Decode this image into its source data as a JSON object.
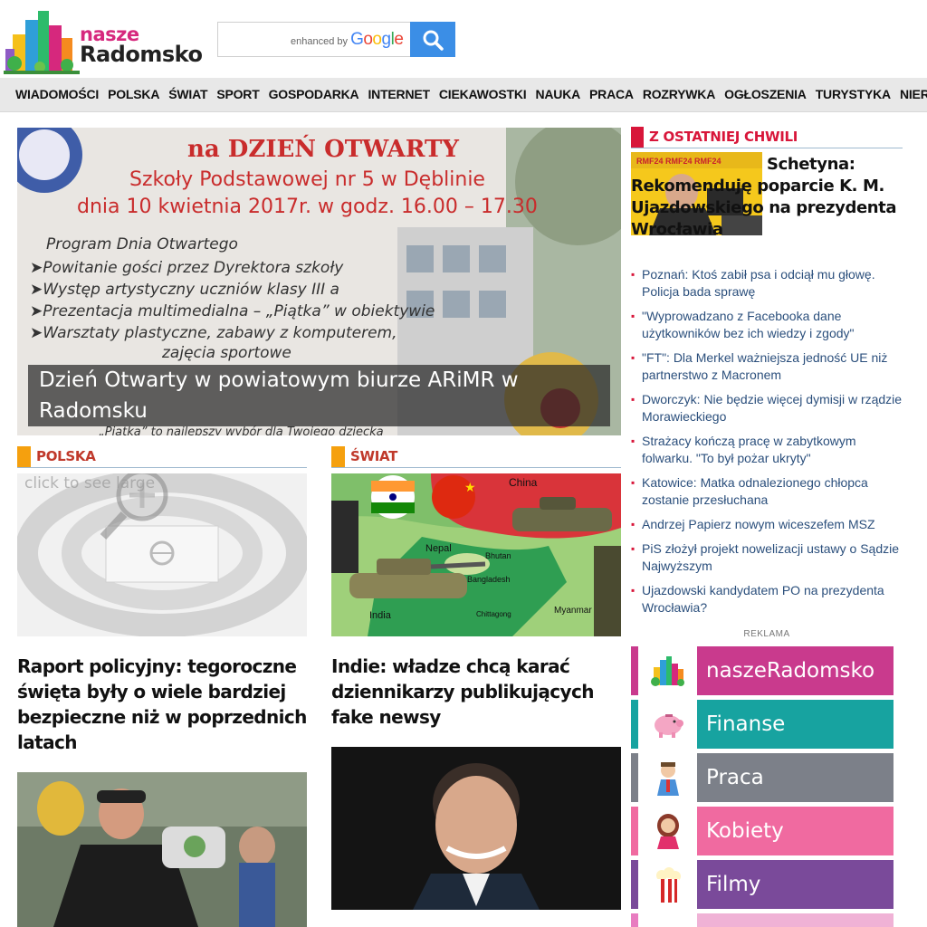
{
  "logo": {
    "line1": "nasze",
    "line2": "Radomsko"
  },
  "search": {
    "brand_prefix": "enhanced by",
    "brand_name": "Google",
    "value": ""
  },
  "nav": [
    "WIADOMOŚCI",
    "POLSKA",
    "ŚWIAT",
    "SPORT",
    "GOSPODARKA",
    "INTERNET",
    "CIEKAWOSTKI",
    "NAUKA",
    "PRACA",
    "ROZRYWKA",
    "OGŁOSZENIA",
    "TURYSTYKA",
    "NIERUCHOMOŚCI"
  ],
  "hero": {
    "poster_lines": [
      "na DZIEŃ OTWARTY",
      "Szkoły Podstawowej nr 5 w Dęblinie",
      "dnia 10 kwietnia 2017r. w godz. 16.00 – 17.30",
      "Program Dnia Otwartego",
      "➤Powitanie gości przez Dyrektora szkoły",
      "➤Występ artystyczny uczniów klasy III a",
      "➤Prezentacja multimedialna – „Piątka” w obiektywie",
      "➤Warsztaty plastyczne, zabawy z komputerem,",
      "zajęcia sportowe",
      "„Piątka” to najlepszy wybór dla Twojego dziecka"
    ],
    "title": "Dzień Otwarty w powiatowym biurze ARiMR w Radomsku"
  },
  "sections": {
    "polska": {
      "label": "POLSKA",
      "image_text": "click to see large",
      "article_title": "Raport policyjny: tegoroczne święta były o wiele bardziej bezpieczne niż w poprzednich latach"
    },
    "swiat": {
      "label": "ŚWIAT",
      "map_labels": [
        "China",
        "Nepal",
        "Bhutan",
        "Bangladesh",
        "India",
        "Myanmar",
        "Chittagong"
      ],
      "article_title": "Indie: władze chcą karać dziennikarzy publikujących fake newsy"
    }
  },
  "breaking": {
    "label": "Z OSTATNIEJ CHWILI",
    "top_story": "Schetyna: Rekomenduję poparcie K. M. Ujazdowskiego na prezydenta Wrocławia",
    "items": [
      "Poznań: Ktoś zabił psa i odciął mu głowę. Policja bada sprawę",
      "\"Wyprowadzano z Facebooka dane użytkowników bez ich wiedzy i zgody\"",
      "\"FT\": Dla Merkel ważniejsza jedność UE niż partnerstwo z Macronem",
      "Dworczyk: Nie będzie więcej dymisji w rządzie Morawieckiego",
      "Strażacy kończą pracę w zabytkowym folwarku. \"To był pożar ukryty\"",
      "Katowice: Matka odnalezionego chłopca zostanie przesłuchana",
      "Andrzej Papierz nowym wiceszefem MSZ",
      "PiS złożył projekt nowelizacji ustawy o Sądzie Najwyższym",
      "Ujazdowski kandydatem PO na prezydenta Wrocławia?"
    ]
  },
  "ads": {
    "label": "REKLAMA",
    "rows": [
      {
        "label": "naszeRadomsko",
        "icon": "city-icon",
        "color": "#c93a8d"
      },
      {
        "label": "Finanse",
        "icon": "piggy-bank-icon",
        "color": "#17a3a0"
      },
      {
        "label": "Praca",
        "icon": "worker-icon",
        "color": "#7c8089"
      },
      {
        "label": "Kobiety",
        "icon": "woman-icon",
        "color": "#f06aa0"
      },
      {
        "label": "Filmy",
        "icon": "popcorn-icon",
        "color": "#7a4a9a"
      }
    ]
  }
}
